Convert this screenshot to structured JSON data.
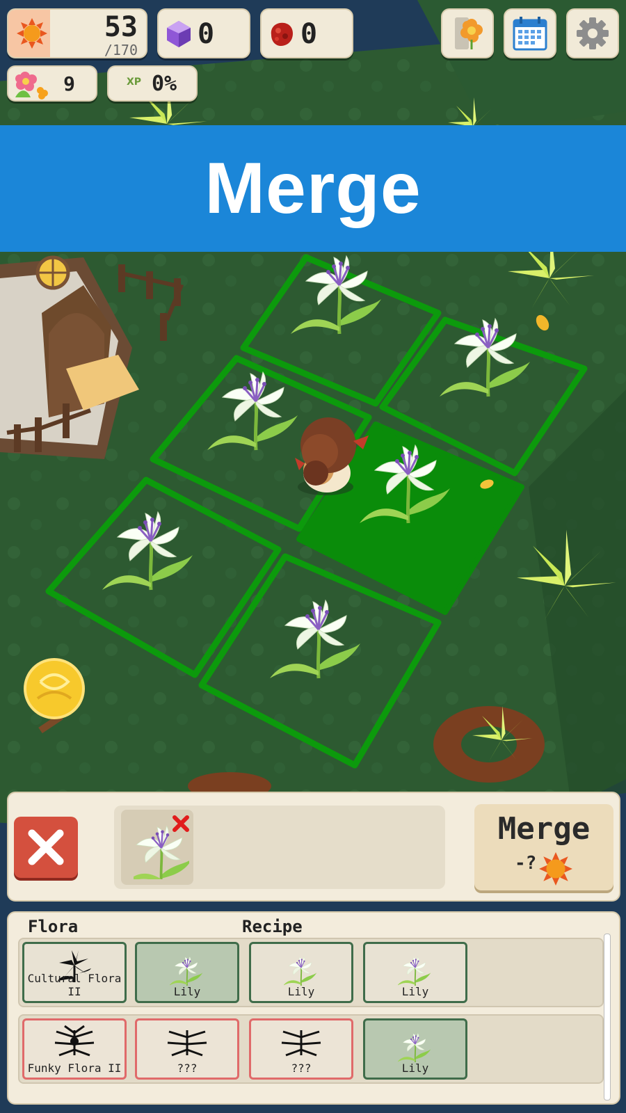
{
  "hud": {
    "sun_value": "53",
    "sun_max": "/170",
    "gem_value": "0",
    "ruby_value": "0",
    "flower_value": "9",
    "xp_label": "XP",
    "xp_value": "0%",
    "buttons": [
      "flower-album-icon",
      "calendar-icon",
      "gear-icon"
    ]
  },
  "banner": {
    "title": "Merge"
  },
  "merge_panel": {
    "slots": [
      {
        "item": "lily",
        "removable": true
      }
    ],
    "merge_label": "Merge",
    "merge_cost": "-?"
  },
  "recipe_panel": {
    "flora_header": "Flora",
    "recipe_header": "Recipe",
    "rows": [
      {
        "flora": "Cultural Flora II",
        "ingredients": [
          "Lily",
          "Lily",
          "Lily"
        ]
      },
      {
        "flora": "Funky Flora II",
        "ingredients": [
          "???",
          "???",
          "Lily"
        ]
      }
    ]
  },
  "colors": {
    "banner": "#1b86d8",
    "panel": "#f3ecdc",
    "cancel": "#d4503e",
    "highlight_tile": "#0a8c0a",
    "tile_outline": "#0c9a0c"
  }
}
